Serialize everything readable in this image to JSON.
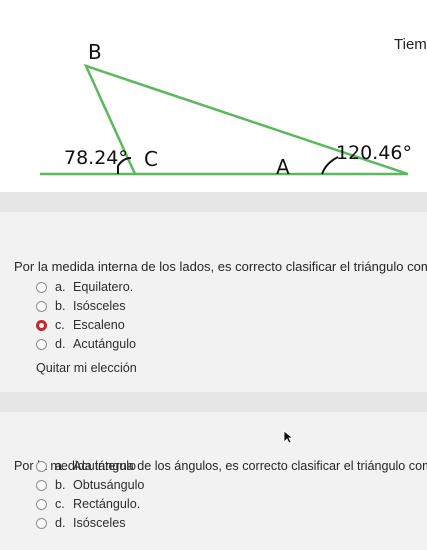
{
  "figure": {
    "vertex_b": "B",
    "vertex_c": "C",
    "vertex_a": "A",
    "angle_c": "78.24°",
    "angle_a": "120.46°",
    "timer_label": "Tiemp"
  },
  "question1": {
    "text": "Por la medida interna de los lados, es correcto clasificar el triángulo como:",
    "options": [
      {
        "letter": "a.",
        "label": "Equilatero."
      },
      {
        "letter": "b.",
        "label": "Isósceles"
      },
      {
        "letter": "c.",
        "label": "Escaleno"
      },
      {
        "letter": "d.",
        "label": "Acutángulo"
      }
    ],
    "selected": "c.",
    "clear_label": "Quitar mi elección"
  },
  "question2": {
    "text": "Por la medida interna de los ángulos, es correcto clasificar el triángulo como",
    "options": [
      {
        "letter": "a.",
        "label": "Acutángulo"
      },
      {
        "letter": "b.",
        "label": "Obtusángulo"
      },
      {
        "letter": "c.",
        "label": "Rectángulo."
      },
      {
        "letter": "d.",
        "label": "Isósceles"
      }
    ],
    "selected": ""
  },
  "colors": {
    "triangle": "#5cb85c",
    "selected_radio": "#c62828"
  }
}
